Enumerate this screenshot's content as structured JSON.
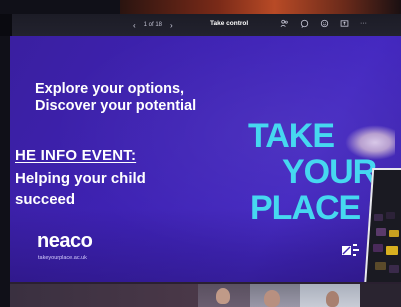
{
  "toolbar": {
    "prev_arrow": "‹",
    "page_count": "1 of 18",
    "next_arrow": "›",
    "take_control": "Take control",
    "icons": [
      "people-icon",
      "chat-icon",
      "reactions-icon",
      "share-icon",
      "more-icon"
    ],
    "more_label": "···"
  },
  "slide": {
    "subtitle": "Explore your options,\nDiscover your potential",
    "event_heading": "HE INFO EVENT:",
    "event_body": "Helping your child\nsucceed",
    "neaco_logo": "neaco",
    "neaco_url": "takeyourplace.ac.uk",
    "brand_lines": [
      "TAKE",
      "YOUR",
      "PLACE"
    ],
    "brand_color": "#46d8f0",
    "background_color": "#3e22b4"
  }
}
